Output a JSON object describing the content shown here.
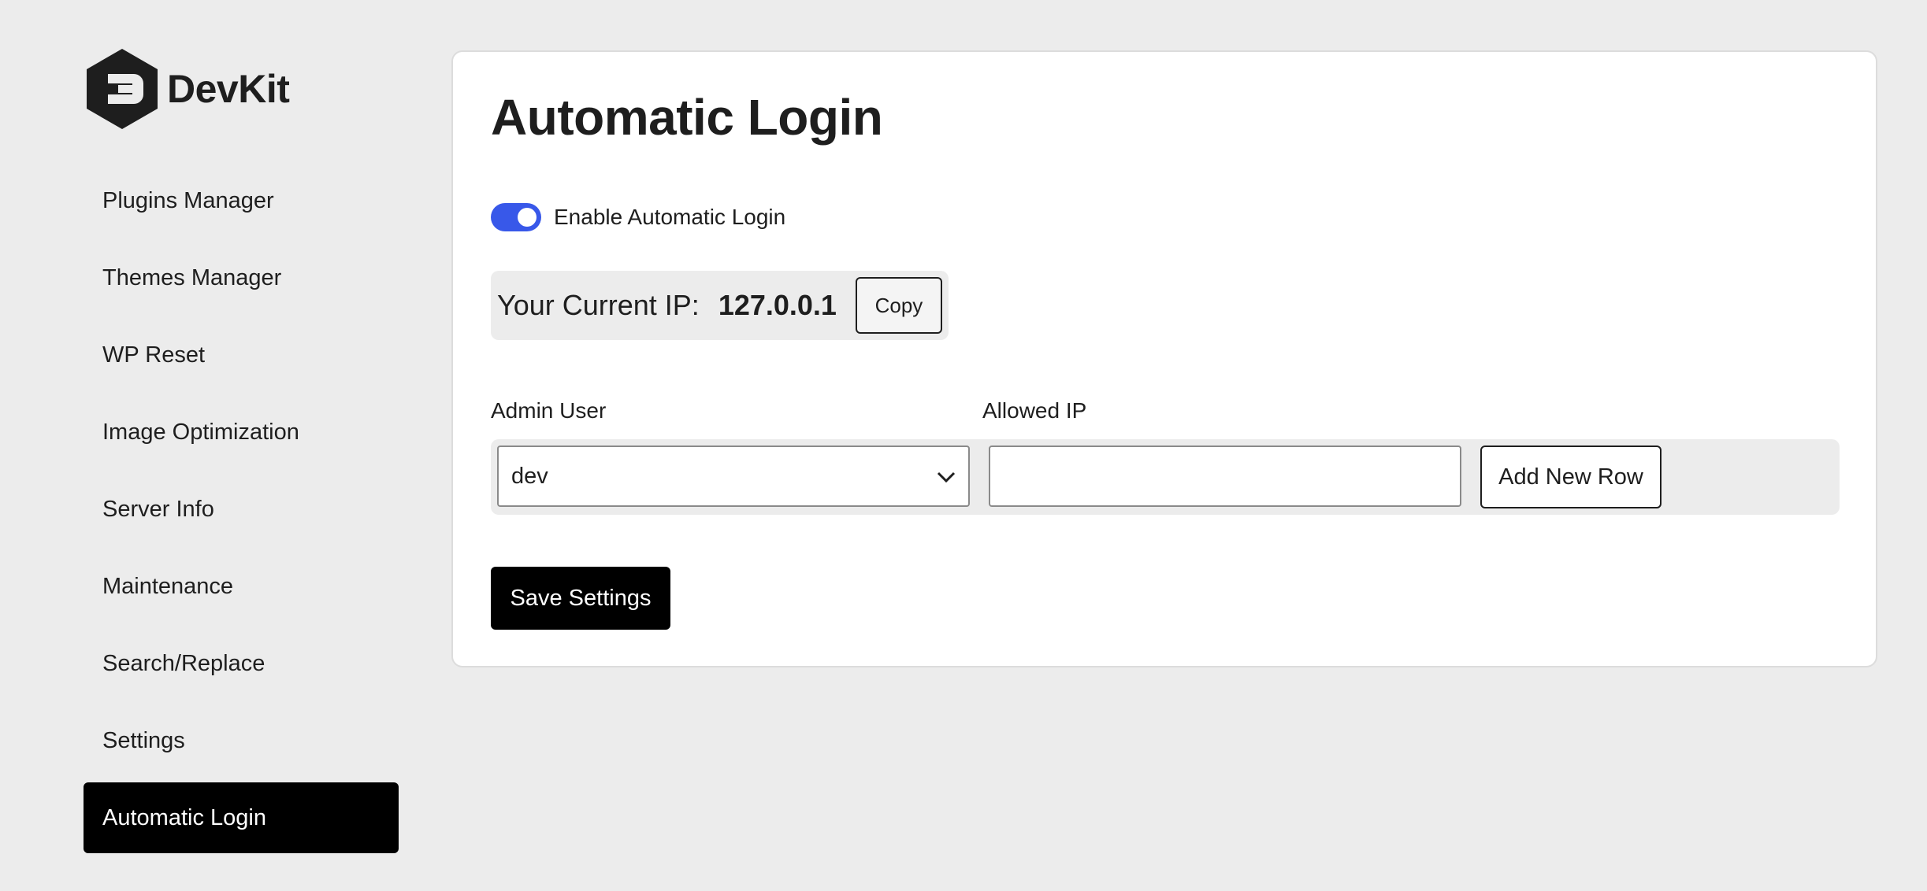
{
  "brand": {
    "name": "DevKit",
    "logo_icon": "devkit-logo-icon"
  },
  "sidebar": {
    "items": [
      {
        "label": "Plugins Manager",
        "active": false
      },
      {
        "label": "Themes Manager",
        "active": false
      },
      {
        "label": "WP Reset",
        "active": false
      },
      {
        "label": "Image Optimization",
        "active": false
      },
      {
        "label": "Server Info",
        "active": false
      },
      {
        "label": "Maintenance",
        "active": false
      },
      {
        "label": "Search/Replace",
        "active": false
      },
      {
        "label": "Settings",
        "active": false
      },
      {
        "label": "Automatic Login",
        "active": true
      }
    ]
  },
  "main": {
    "title": "Automatic Login",
    "toggle": {
      "label": "Enable Automatic Login",
      "enabled": true,
      "color": "#3858e9"
    },
    "current_ip": {
      "label": "Your Current IP:",
      "value": "127.0.0.1",
      "copy_label": "Copy"
    },
    "table": {
      "admin_user_label": "Admin User",
      "allowed_ip_label": "Allowed IP",
      "admin_user_value": "dev",
      "allowed_ip_value": "",
      "add_row_label": "Add New Row"
    },
    "save_label": "Save Settings"
  }
}
